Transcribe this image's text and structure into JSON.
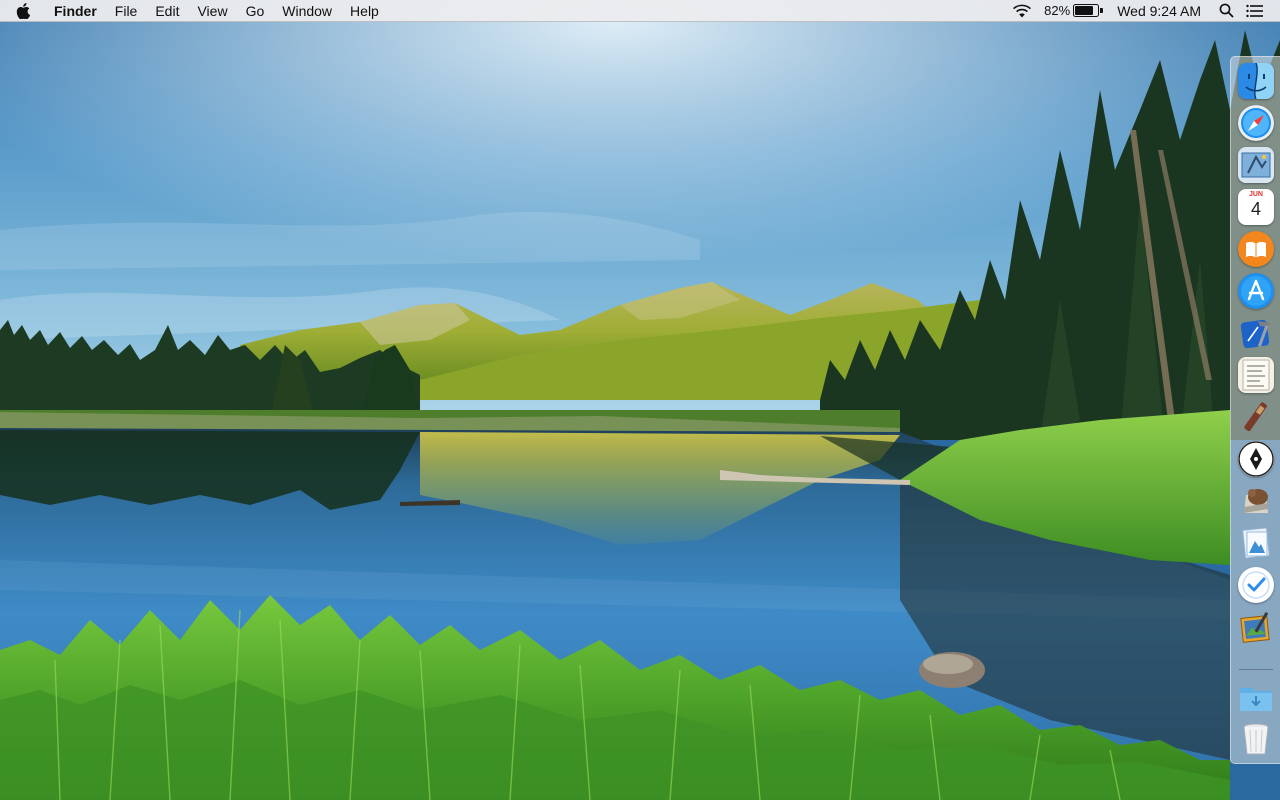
{
  "menubar": {
    "apple_icon": "apple-logo-icon",
    "app_name": "Finder",
    "menus": [
      "File",
      "Edit",
      "View",
      "Go",
      "Window",
      "Help"
    ],
    "battery_percent": "82%",
    "battery_level": 0.82,
    "clock": "Wed 9:24 AM",
    "icons": [
      "wifi-icon",
      "battery-icon",
      "spotlight-search-icon",
      "notification-center-icon"
    ]
  },
  "dock": {
    "apps": [
      {
        "name": "finder-icon",
        "running": true
      },
      {
        "name": "safari-icon",
        "running": true
      },
      {
        "name": "mail-icon",
        "running": true
      },
      {
        "name": "calendar-icon",
        "running": false
      },
      {
        "name": "ibooks-icon",
        "running": false
      },
      {
        "name": "app-store-icon",
        "running": false
      },
      {
        "name": "xcode-icon",
        "running": false
      },
      {
        "name": "script-editor-icon",
        "running": false
      },
      {
        "name": "instruments-icon",
        "running": false
      },
      {
        "name": "pen-tool-icon",
        "running": false
      },
      {
        "name": "squirrel-app-icon",
        "running": false
      },
      {
        "name": "preview-icon",
        "running": false
      },
      {
        "name": "tasks-checkmark-icon",
        "running": false
      },
      {
        "name": "photo-editor-icon",
        "running": false
      }
    ],
    "calendar": {
      "month": "JUN",
      "day": "4"
    },
    "stack": [
      {
        "name": "downloads-folder-icon"
      },
      {
        "name": "trash-icon"
      }
    ]
  },
  "colors": {
    "menubar_bg": "#ececee",
    "sky_top": "#3f7fb3",
    "sky_horizon": "#8fc0dd",
    "lake": "#2f78b8",
    "grass": "#4caf28"
  }
}
